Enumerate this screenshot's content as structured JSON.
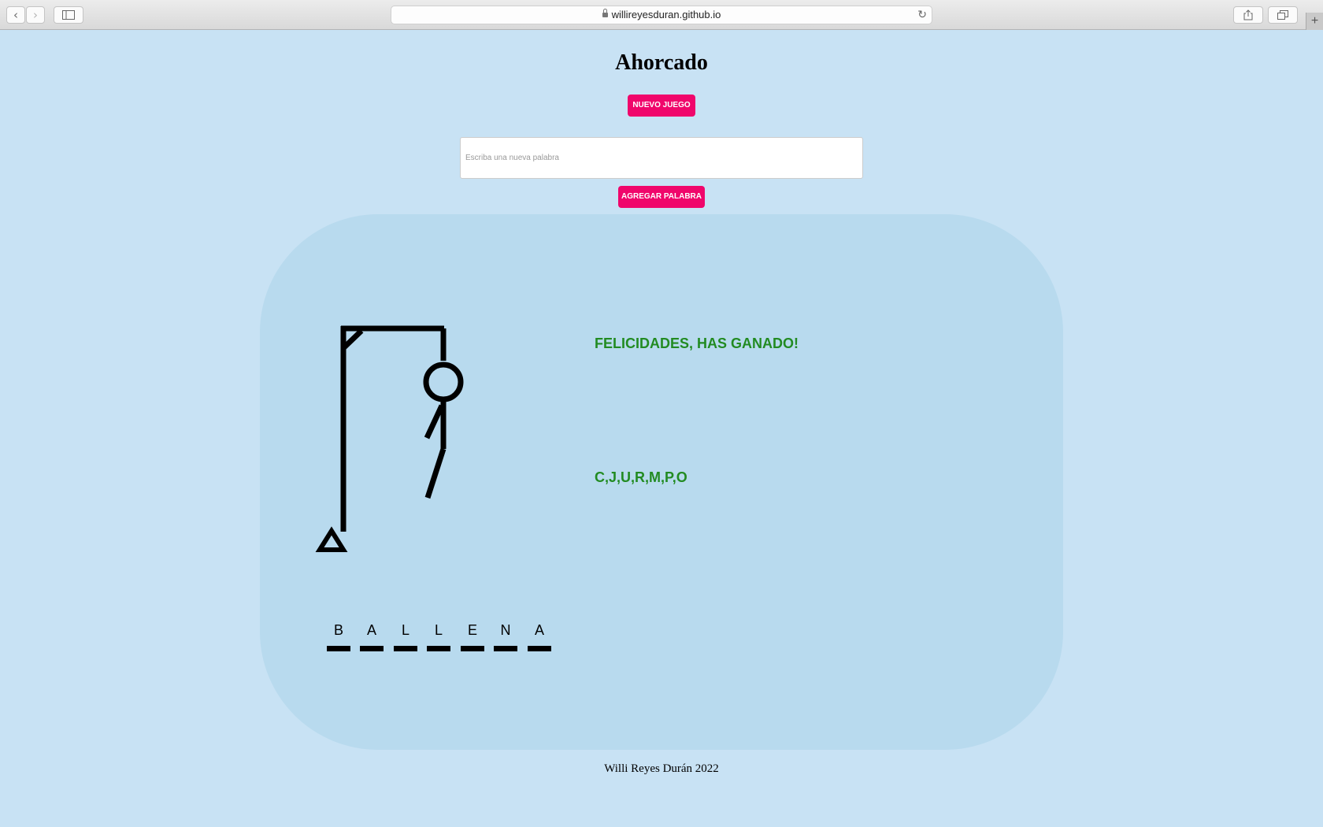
{
  "browser": {
    "url": "willireyesduran.github.io"
  },
  "page": {
    "title": "Ahorcado",
    "new_game_label": "NUEVO JUEGO",
    "input_placeholder": "Escriba una nueva palabra",
    "input_value": "",
    "add_word_label": "AGREGAR PALABRA",
    "message": "FELICIDADES, HAS GANADO!",
    "used_letters": "C,J,U,R,M,P,O",
    "word_letters": [
      "B",
      "A",
      "L",
      "L",
      "E",
      "N",
      "A"
    ],
    "footer": "Willi Reyes Durán 2022"
  },
  "colors": {
    "background": "#c8e2f4",
    "board": "#b8daee",
    "button": "#f0066b",
    "message": "#228b22"
  }
}
